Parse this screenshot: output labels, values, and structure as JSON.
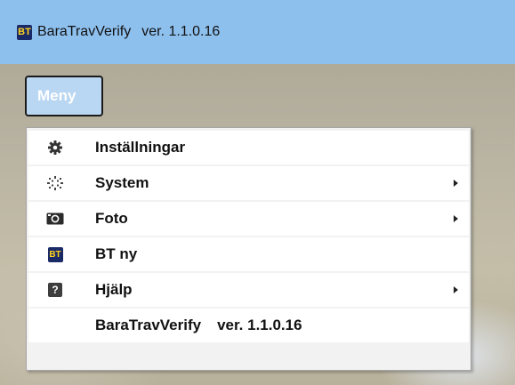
{
  "window": {
    "logo_text": "BT",
    "app_name": "BaraTravVerify",
    "version": "ver. 1.1.0.16",
    "titlebar_color": "#8ec0ee"
  },
  "menu_button": {
    "label": "Meny"
  },
  "menu": {
    "items": [
      {
        "label": "Inställningar",
        "icon": "gear-icon",
        "has_submenu": false
      },
      {
        "label": "System",
        "icon": "system-sparkle-icon",
        "has_submenu": true
      },
      {
        "label": "Foto",
        "icon": "camera-icon",
        "has_submenu": true
      },
      {
        "label": "BT ny",
        "icon": "bt-logo-icon",
        "icon_text": "BT",
        "has_submenu": false
      },
      {
        "label": "Hjälp",
        "icon": "help-icon",
        "icon_text": "?",
        "has_submenu": true
      },
      {
        "label": "BaraTravVerify",
        "version": "ver. 1.1.0.16",
        "has_submenu": false
      }
    ]
  }
}
